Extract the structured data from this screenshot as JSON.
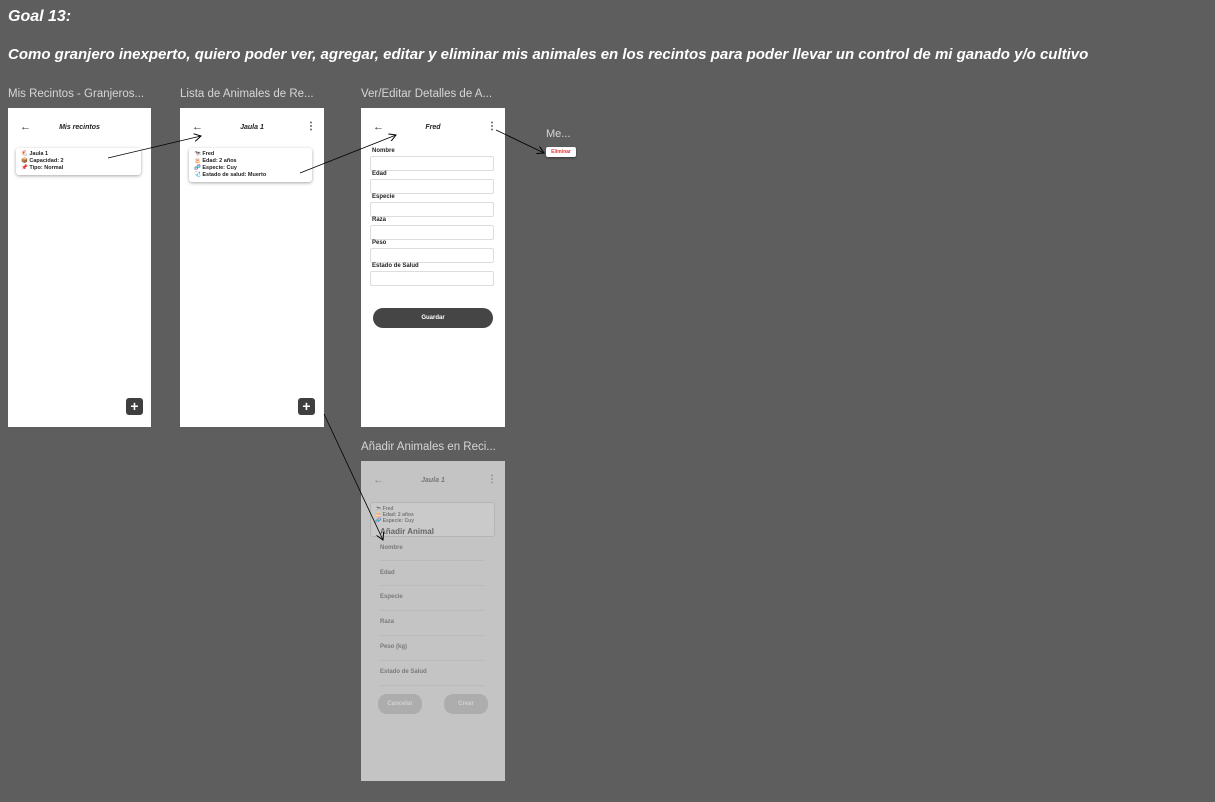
{
  "goal": "Goal 13:",
  "story": "Como granjero inexperto, quiero poder ver, agregar, editar y eliminar mis animales en los recintos para poder llevar un control de mi ganado y/o cultivo",
  "frames": {
    "recintos": {
      "label": "Mis Recintos - Granjeros...",
      "title": "Mis recintos",
      "back": "←",
      "card": [
        "🐔 Jaula 1",
        "📦 Capacidad: 2",
        "📌 Tipo: Normal"
      ],
      "fab": "+"
    },
    "lista": {
      "label": "Lista de Animales de Re...",
      "title": "Jaula 1",
      "back": "←",
      "kebab": "⋮",
      "card": [
        "🐄 Fred",
        "🎂 Edad: 2 años",
        "🧬 Especie: Cuy",
        "🩺 Estado de salud: Muerto"
      ],
      "fab": "+"
    },
    "detalle": {
      "label": "Ver/Editar Detalles de A...",
      "title": "Fred",
      "back": "←",
      "kebab": "⋮",
      "fields": [
        "Nombre",
        "Edad",
        "Especie",
        "Raza",
        "Peso",
        "Estado de Salud"
      ],
      "save": "Guardar"
    },
    "menu": {
      "label": "Me...",
      "item": "Eliminar"
    },
    "anadir": {
      "label": "Añadir Animales en Reci...",
      "title": "Jaula 1",
      "back": "←",
      "kebab": "⋮",
      "card": [
        "🐄 Fred",
        "🎂 Edad: 2 años",
        "🧬 Especie: Cuy"
      ],
      "dialog_title": "Añadir Animal",
      "fields": [
        "Nombre",
        "Edad",
        "Especie",
        "Raza",
        "Peso (kg)",
        "Estado de Salud"
      ],
      "cancel": "Cancelar",
      "create": "Crear"
    }
  },
  "colors": {
    "background": "#5e5e5e",
    "danger": "#e53935",
    "button": "#454545"
  }
}
